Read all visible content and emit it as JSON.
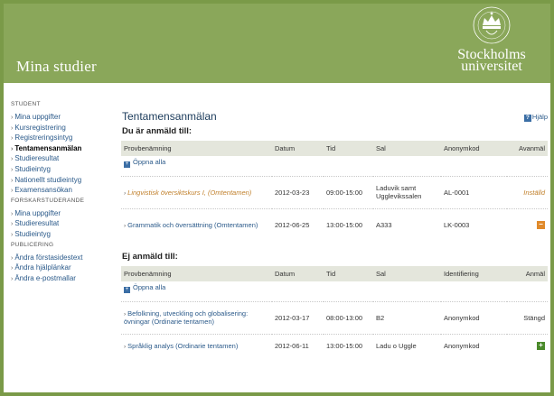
{
  "header": {
    "title": "Mina studier",
    "logo": {
      "line1": "Stockholms",
      "line2": "universitet",
      "ring_text": "STOCKHOLMS UNIVERSITET"
    }
  },
  "sidebar": {
    "groups": [
      {
        "heading": "Student",
        "items": [
          "Mina uppgifter",
          "Kursregistrering",
          "Registreringsintyg",
          "Tentamensanmälan",
          "Studieresultat",
          "Studieintyg",
          "Nationellt studieintyg",
          "Examensansökan"
        ]
      },
      {
        "heading": "Forskarstuderande",
        "items": [
          "Mina uppgifter",
          "Studieresultat",
          "Studieintyg"
        ]
      },
      {
        "heading": "Publicering",
        "items": [
          "Ändra förstasidestext",
          "Ändra hjälplänkar",
          "Ändra e-postmallar"
        ]
      }
    ],
    "active_item": "Tentamensanmälan"
  },
  "main": {
    "title": "Tentamensanmälan",
    "help": "Hjälp",
    "registered": {
      "heading": "Du är anmäld till:",
      "columns": [
        "Provbenämning",
        "Datum",
        "Tid",
        "Sal",
        "Anonymkod",
        "Avanmäl"
      ],
      "open_all": "Öppna alla",
      "rows": [
        {
          "course": "Lingvistisk översiktskurs I, (Omtentamen)",
          "date": "2012-03-23",
          "time": "09:00-15:00",
          "room": "Laduvik samt Ugglevikssalen",
          "code": "AL-0001",
          "status": "Inställd",
          "cancelled": true
        },
        {
          "course": "Grammatik och översättning (Omtentamen)",
          "date": "2012-06-25",
          "time": "13:00-15:00",
          "room": "A333",
          "code": "LK-0003",
          "status": "",
          "cancelled": false
        }
      ]
    },
    "unregistered": {
      "heading": "Ej anmäld till:",
      "columns": [
        "Provbenämning",
        "Datum",
        "Tid",
        "Sal",
        "Identifiering",
        "Anmäl"
      ],
      "open_all": "Öppna alla",
      "rows": [
        {
          "course": "Befolkning, utveckling och globalisering: övningar (Ordinarie tentamen)",
          "date": "2012-03-17",
          "time": "08:00-13:00",
          "room": "B2",
          "id": "Anonymkod",
          "status": "Stängd"
        },
        {
          "course": "Språklig analys (Ordinarie tentamen)",
          "date": "2012-06-11",
          "time": "13:00-15:00",
          "room": "Ladu o Uggle",
          "id": "Anonymkod",
          "status": ""
        }
      ]
    }
  },
  "colors": {
    "header_green": "#8aa75a",
    "frame_green": "#7a9a48",
    "link_blue": "#2b5a8a",
    "cancelled_orange": "#c07f2a",
    "plus_green": "#4a8a2a",
    "minus_orange": "#e08a2a"
  }
}
